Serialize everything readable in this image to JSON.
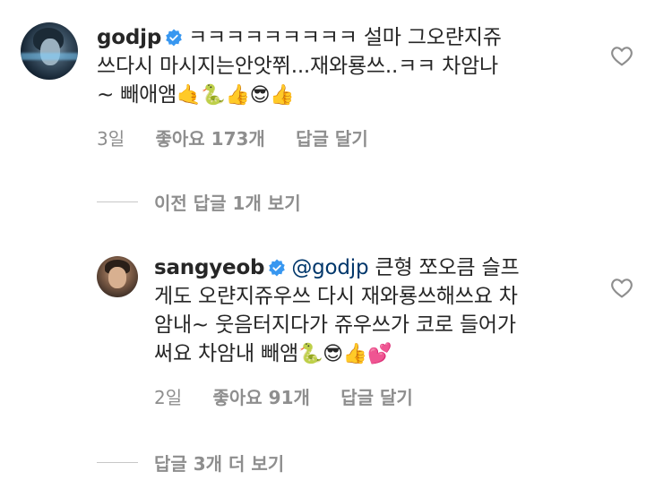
{
  "comments": [
    {
      "username": "godjp",
      "line1": "ㅋㅋㅋㅋㅋㅋㅋㅋㅋ 설마 그오랸지쥬",
      "line2": "쓰다시 마시지는안앗쮜...재와룡쓰..ㅋㅋ 차암나",
      "line3": "~ 빼애앰",
      "emojis": "🤙🐍👍😎👍",
      "time": "3일",
      "likes": "좋아요 173개",
      "reply": "답글 달기"
    }
  ],
  "view_previous": "이전 답글 1개 보기",
  "reply_comment": {
    "username": "sangyeob",
    "mention": "@godjp",
    "line1_rest": " 큰형 쪼오큼 슬프",
    "line2": "게도 오랸지쥬우쓰 다시 재와룡쓰해쓰요 차",
    "line3": "암내~ 웃음터지다가 쥬우쓰가 코로 들어가",
    "line4": "써요 차암내 빼앰",
    "emojis": "🐍😎👍💕",
    "time": "2일",
    "likes": "좋아요 91개",
    "reply": "답글 달기"
  },
  "view_more": "답글 3개 더 보기",
  "icons": {
    "verified": "verified-badge-icon",
    "heart": "heart-outline-icon"
  },
  "colors": {
    "verified": "#3897f0",
    "meta": "#8e8e8e",
    "mention": "#00376b"
  }
}
